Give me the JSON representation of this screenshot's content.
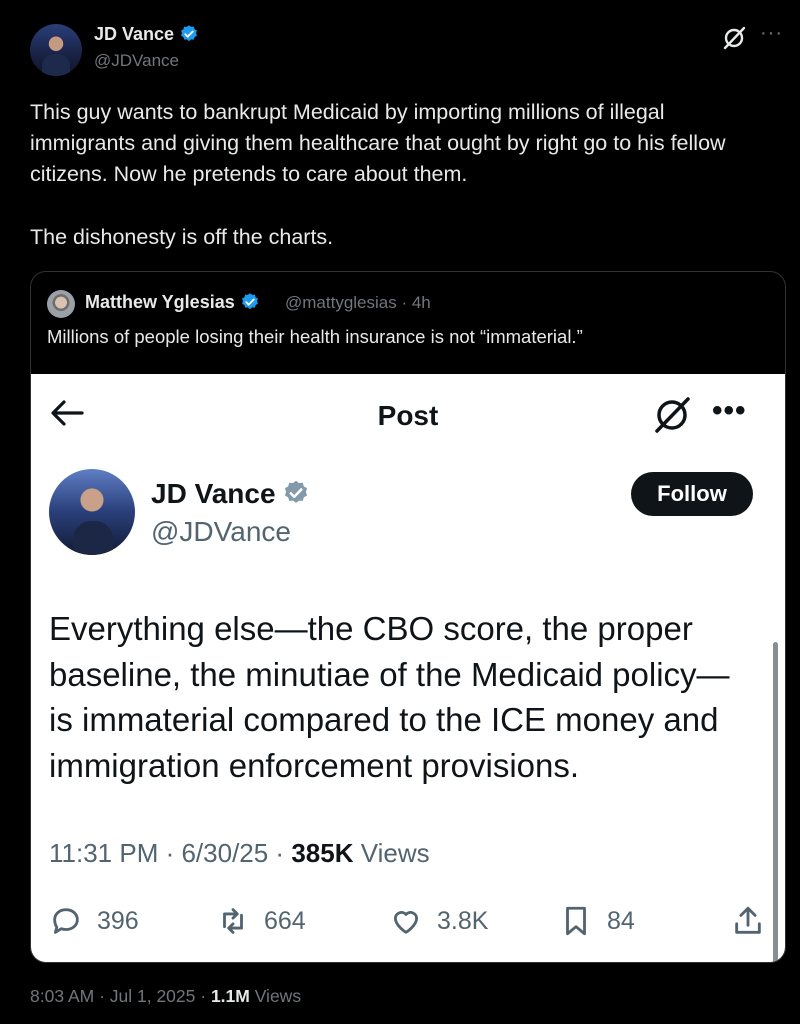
{
  "outer_tweet": {
    "author_name": "JD Vance",
    "author_handle": "@JDVance",
    "text": "This guy wants to bankrupt Medicaid by importing millions of illegal immigrants and giving them healthcare that ought by right go to his fellow citizens. Now he pretends to care about them.\n\nThe dishonesty is off the charts.",
    "time": "8:03 AM · Jul 1, 2025 · ",
    "views_count": "1.1M",
    "views_label": " Views"
  },
  "quote_tweet": {
    "author_name": "Matthew Yglesias",
    "author_handle": "@mattyglesias · 4h",
    "text": "Millions of people losing their health insurance is not “immaterial.”"
  },
  "embedded_post": {
    "header_title": "Post",
    "author_name": "JD Vance",
    "author_handle": "@JDVance",
    "follow_label": "Follow",
    "text": "Everything else—the CBO score, the proper\nbaseline, the minutiae of the Medicaid policy—\nis immaterial compared to the ICE money and\nimmigration enforcement provisions.",
    "time": "11:31 PM · 6/30/25 · ",
    "views_count": "385K",
    "views_label": " Views",
    "stats": {
      "replies": "396",
      "reposts": "664",
      "likes": "3.8K",
      "bookmarks": "84"
    }
  },
  "icons": [
    "verified-badge-icon",
    "grok-icon",
    "more-icon",
    "back-arrow-icon",
    "reply-icon",
    "repost-icon",
    "like-icon",
    "bookmark-icon",
    "share-icon"
  ],
  "colors": {
    "background": "#000000",
    "verified": "#1d9bf0",
    "muted": "#71767b",
    "text": "#e7e9ea",
    "embedded_bg": "#ffffff"
  }
}
